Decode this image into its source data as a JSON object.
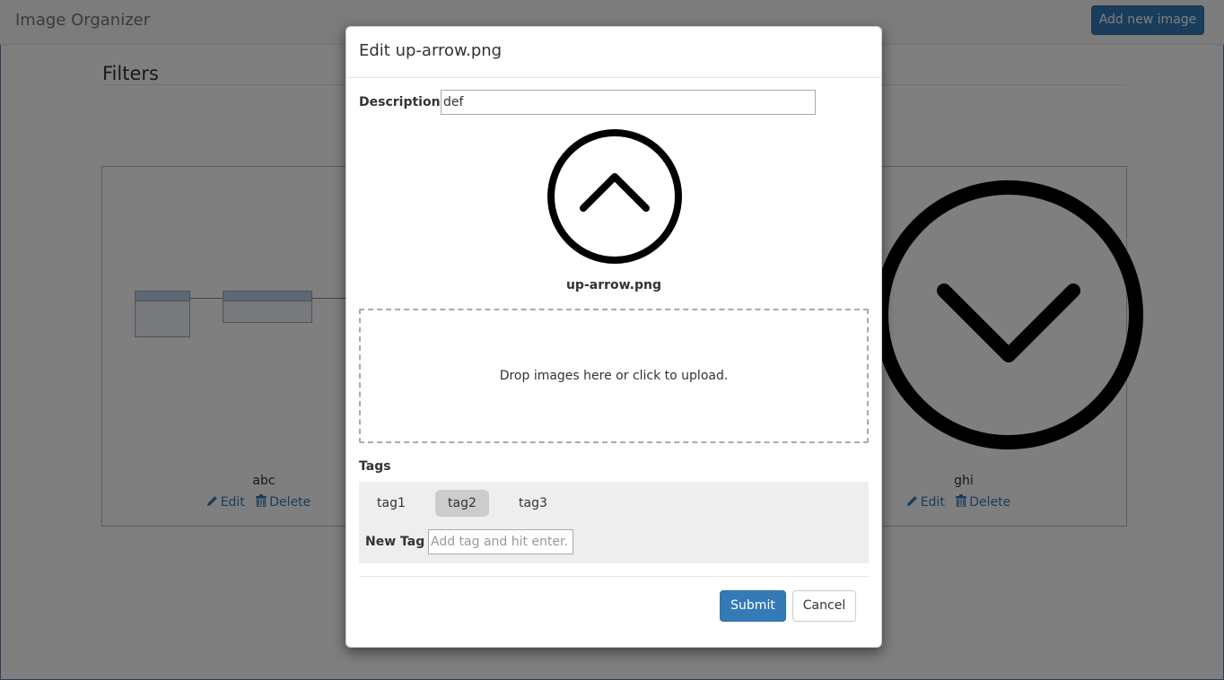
{
  "app": {
    "title": "Image Organizer",
    "add_new_label": "Add new image"
  },
  "filters": {
    "title": "Filters"
  },
  "gallery": {
    "cards": [
      {
        "caption": "abc",
        "edit_label": "Edit",
        "delete_label": "Delete",
        "thumbnail": "database-diagram"
      },
      {
        "caption": "ghi",
        "edit_label": "Edit",
        "delete_label": "Delete",
        "thumbnail": "down-arrow-circle-icon"
      }
    ]
  },
  "modal": {
    "title": "Edit up-arrow.png",
    "description_label": "Description",
    "description_value": "def",
    "preview_icon": "up-arrow-circle-icon",
    "filename": "up-arrow.png",
    "dropzone_text": "Drop images here or click to upload.",
    "tags_label": "Tags",
    "tags": [
      {
        "label": "tag1",
        "selected": false
      },
      {
        "label": "tag2",
        "selected": true
      },
      {
        "label": "tag3",
        "selected": false
      }
    ],
    "new_tag_label": "New Tag",
    "new_tag_placeholder": "Add tag and hit enter.",
    "submit_label": "Submit",
    "cancel_label": "Cancel"
  },
  "colors": {
    "primary": "#337ab7",
    "link": "#337ab7",
    "selected_tag": "#cccccc",
    "tags_panel": "#eeeeee"
  }
}
